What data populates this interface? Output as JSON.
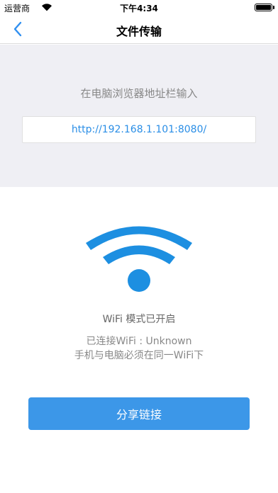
{
  "status_bar": {
    "carrier": "运营商",
    "time": "下午4:34",
    "battery_level": 1.0
  },
  "nav": {
    "title": "文件传输",
    "back_icon": "chevron-left-icon"
  },
  "address_panel": {
    "instruction": "在电脑浏览器地址栏输入",
    "url": "http://192.168.1.101:8080/"
  },
  "wifi": {
    "icon": "wifi-icon",
    "color": "#1d8fe1",
    "mode_text": "WiFi 模式已开启",
    "connected_text": "已连接WiFi : Unknown",
    "same_network_text": "手机与电脑必须在同一WiFi下"
  },
  "actions": {
    "share_label": "分享链接",
    "share_color": "#3c97e8"
  }
}
